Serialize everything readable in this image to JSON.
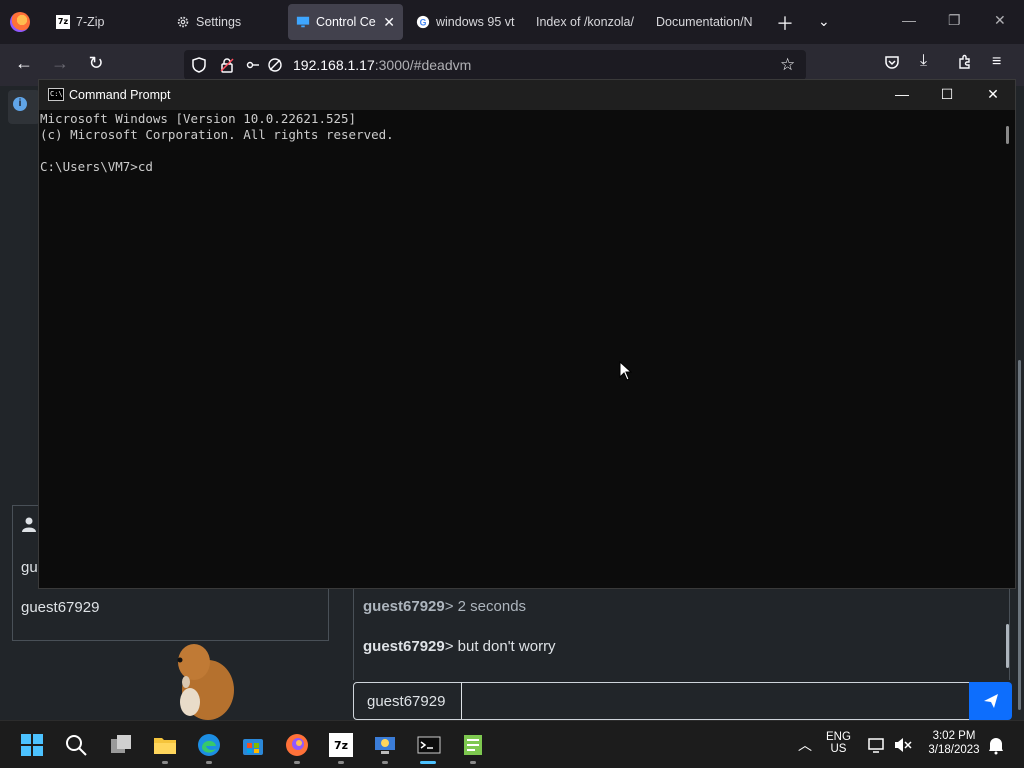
{
  "browser": {
    "tabs": [
      {
        "label": "7-Zip",
        "icon": "7zip-icon"
      },
      {
        "label": "Settings",
        "icon": "gear-icon"
      },
      {
        "label": "Control Cen",
        "icon": "monitor-icon",
        "active": true
      },
      {
        "label": "windows 95 vt",
        "icon": "google-icon"
      },
      {
        "label": "Index of /konzola/",
        "icon": "none"
      },
      {
        "label": "Documentation/N",
        "icon": "none"
      }
    ],
    "url_host": "192.168.1.17",
    "url_rest": ":3000/#deadvm",
    "info_icon": "i"
  },
  "cmd": {
    "title": "Command Prompt",
    "lines": [
      "Microsoft Windows [Version 10.0.22621.525]",
      "(c) Microsoft Corporation. All rights reserved.",
      "",
      "C:\\Users\\VM7>cd"
    ]
  },
  "userlist": {
    "users": [
      "gu",
      "guest67929"
    ]
  },
  "chat": {
    "messages": [
      {
        "user": "guest67929",
        "text": " 2 seconds",
        "faded": true
      },
      {
        "user": "guest67929",
        "text": " but don't worry",
        "faded": false
      }
    ],
    "prompt_suffix": ">",
    "username": "guest67929",
    "input_value": ""
  },
  "taskbar": {
    "lang": "ENG",
    "region": "US",
    "time": "3:02 PM",
    "date": "3/18/2023"
  },
  "colors": {
    "accent": "#0d6efd",
    "browser_bg": "#1c1b22",
    "terminal_bg": "#0c0c0c"
  }
}
